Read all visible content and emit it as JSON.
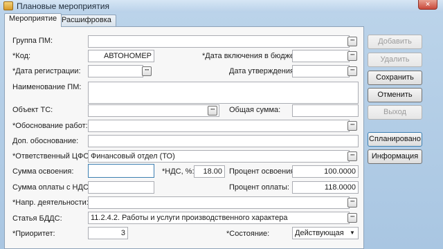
{
  "window": {
    "title": "Плановые мероприятия",
    "close_glyph": "✕"
  },
  "tabs": [
    {
      "label": "Мероприятие",
      "active": true
    },
    {
      "label": "Расшифровка",
      "active": false
    }
  ],
  "form": {
    "group_pm": {
      "label": "Группа ПМ:",
      "value": ""
    },
    "code": {
      "label": "*Код:",
      "value": "АВТОНОМЕР"
    },
    "budget_date": {
      "label": "*Дата включения в бюджет:",
      "value": ""
    },
    "reg_date": {
      "label": "*Дата регистрации:",
      "value": ""
    },
    "approve_date": {
      "label": "Дата утверждения:",
      "value": ""
    },
    "name_pm": {
      "label": "Наименование ПМ:",
      "value": ""
    },
    "object_ts": {
      "label": "Объект ТС:",
      "value": ""
    },
    "total_sum": {
      "label": "Общая сумма:",
      "value": ""
    },
    "justification": {
      "label": "*Обоснование работ:",
      "value": ""
    },
    "extra_justification": {
      "label": "Доп. обоснование:",
      "value": ""
    },
    "responsible_cfo": {
      "label": "*Ответственный ЦФО:",
      "value": "Финансовый отдел (ТО)"
    },
    "development_sum": {
      "label": "Сумма освоения:",
      "value": ""
    },
    "vat": {
      "label": "*НДС, %:",
      "value": "18.00"
    },
    "development_percent": {
      "label": "Процент освоения:",
      "value": "100.0000"
    },
    "payment_sum": {
      "label": "Сумма оплаты с НДС:",
      "value": ""
    },
    "payment_percent": {
      "label": "Процент оплаты:",
      "value": "118.0000"
    },
    "activity_direction": {
      "label": "*Напр. деятельности:",
      "value": ""
    },
    "bdds_item": {
      "label": "Статья БДДС:",
      "value": "11.2.4.2. Работы и услуги производственного характера"
    },
    "priority": {
      "label": "*Приоритет:",
      "value": "3"
    },
    "state": {
      "label": "*Состояние:",
      "value": "Действующая"
    }
  },
  "buttons": {
    "add": {
      "label": "Добавить",
      "enabled": false
    },
    "delete": {
      "label": "Удалить",
      "enabled": false
    },
    "save": {
      "label": "Сохранить",
      "enabled": true
    },
    "cancel": {
      "label": "Отменить",
      "enabled": true
    },
    "exit": {
      "label": "Выход",
      "enabled": false
    },
    "planned": {
      "label": "Спланировано",
      "enabled": true
    },
    "info": {
      "label": "Информация",
      "enabled": true
    }
  },
  "ellipsis": "···",
  "dropdown_glyph": "▼"
}
